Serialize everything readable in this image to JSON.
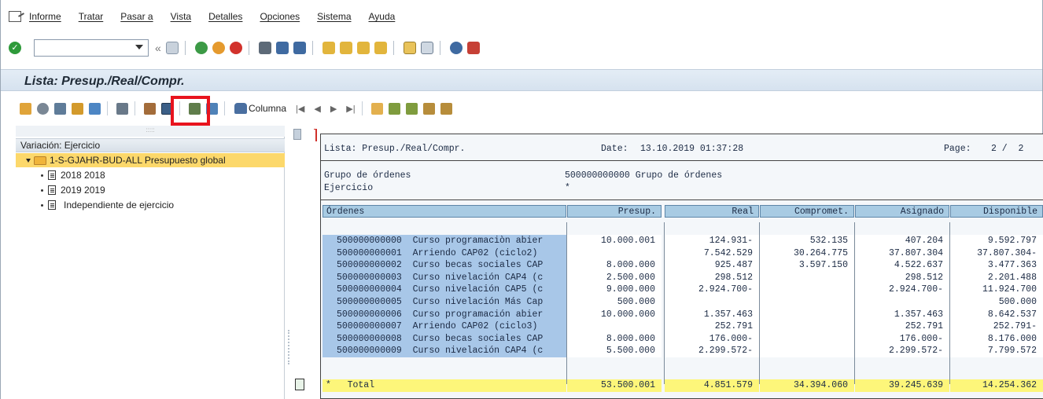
{
  "menu": {
    "items": [
      "Informe",
      "Tratar",
      "Pasar a",
      "Vista",
      "Detalles",
      "Opciones",
      "Sistema",
      "Ayuda"
    ]
  },
  "systoolbar": {
    "command_value": "",
    "back_chevron": "«"
  },
  "title": "Lista: Presup./Real/Compr.",
  "apptoolbar": {
    "column_label": "Columna"
  },
  "tree": {
    "header": "Variación: Ejercicio",
    "root": "1-S-GJAHR-BUD-ALL Presupuesto global",
    "items": [
      "2018 2018",
      "2019 2019",
      "Independiente de ejercicio"
    ]
  },
  "report": {
    "header_title": "Lista: Presup./Real/Compr.",
    "header_date_label": "Date:",
    "header_date": "13.10.2019 01:37:28",
    "header_page_label": "Page:",
    "header_page": "2 /  2",
    "group_label": "Grupo de órdenes",
    "group_value": "500000000000 Grupo de órdenes",
    "year_label": "Ejercicio",
    "year_value": "*",
    "columns": [
      "Órdenes",
      "Presup.",
      "Real",
      "Compromet.",
      "Asignado",
      "Disponible"
    ],
    "rows": [
      {
        "id": "500000000000",
        "desc": "Curso programaciòn abier",
        "presup": "10.000.001",
        "real": "124.931-",
        "comp": "532.135",
        "asig": "407.204",
        "disp": "9.592.797"
      },
      {
        "id": "500000000001",
        "desc": "Arriendo CAP02 (ciclo2)",
        "presup": "",
        "real": "7.542.529",
        "comp": "30.264.775",
        "asig": "37.807.304",
        "disp": "37.807.304-"
      },
      {
        "id": "500000000002",
        "desc": "Curso becas sociales CAP",
        "presup": "8.000.000",
        "real": "925.487",
        "comp": "3.597.150",
        "asig": "4.522.637",
        "disp": "3.477.363"
      },
      {
        "id": "500000000003",
        "desc": "Curso nivelación CAP4 (c",
        "presup": "2.500.000",
        "real": "298.512",
        "comp": "",
        "asig": "298.512",
        "disp": "2.201.488"
      },
      {
        "id": "500000000004",
        "desc": "Curso nivelación CAP5 (c",
        "presup": "9.000.000",
        "real": "2.924.700-",
        "comp": "",
        "asig": "2.924.700-",
        "disp": "11.924.700"
      },
      {
        "id": "500000000005",
        "desc": "Curso nivelación Más Cap",
        "presup": "500.000",
        "real": "",
        "comp": "",
        "asig": "",
        "disp": "500.000"
      },
      {
        "id": "500000000006",
        "desc": "Curso programación abier",
        "presup": "10.000.000",
        "real": "1.357.463",
        "comp": "",
        "asig": "1.357.463",
        "disp": "8.642.537"
      },
      {
        "id": "500000000007",
        "desc": "Arriendo CAP02 (ciclo3)",
        "presup": "",
        "real": "252.791",
        "comp": "",
        "asig": "252.791",
        "disp": "252.791-"
      },
      {
        "id": "500000000008",
        "desc": "Curso becas sociales CAP",
        "presup": "8.000.000",
        "real": "176.000-",
        "comp": "",
        "asig": "176.000-",
        "disp": "8.176.000"
      },
      {
        "id": "500000000009",
        "desc": "Curso nivelación CAP4 (c",
        "presup": "5.500.000",
        "real": "2.299.572-",
        "comp": "",
        "asig": "2.299.572-",
        "disp": "7.799.572"
      }
    ],
    "total": {
      "mark": "*",
      "label": "Total",
      "presup": "53.500.001",
      "real": "4.851.579",
      "comp": "34.394.060",
      "asig": "39.245.639",
      "disp": "14.254.362"
    }
  }
}
